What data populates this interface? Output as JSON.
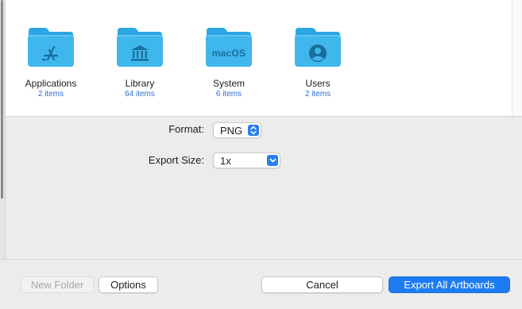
{
  "folders": [
    {
      "name": "Applications",
      "count": "2 items",
      "icon": "app-store-icon"
    },
    {
      "name": "Library",
      "count": "64 items",
      "icon": "building-columns-icon"
    },
    {
      "name": "System",
      "count": "6 items",
      "icon": "macos-text-icon",
      "glyph_text": "macOS"
    },
    {
      "name": "Users",
      "count": "2 items",
      "icon": "person-circle-icon"
    }
  ],
  "options": {
    "format_label": "Format:",
    "format_value": "PNG",
    "size_label": "Export Size:",
    "size_value": "1x"
  },
  "footer": {
    "new_folder_label": "New Folder",
    "options_label": "Options",
    "cancel_label": "Cancel",
    "export_label": "Export All Artboards"
  },
  "colors": {
    "folder_body": "#3fb6ec",
    "folder_tab": "#2aa6e3",
    "folder_glyph": "#1a6e9c",
    "item_count": "#2f6fd6",
    "accent": "#1e7cf2"
  }
}
